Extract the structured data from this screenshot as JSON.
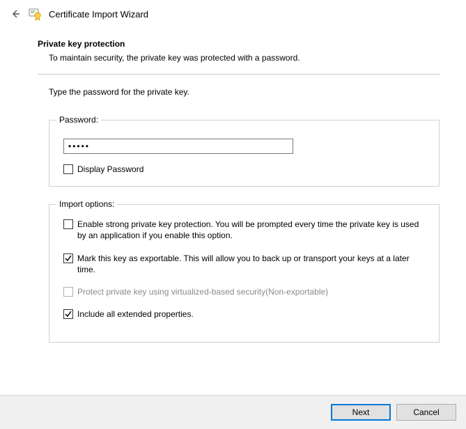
{
  "title": "Certificate Import Wizard",
  "heading": "Private key protection",
  "subheading": "To maintain security, the private key was protected with a password.",
  "instruction": "Type the password for the private key.",
  "password_group_label": "Password:",
  "password_value": "•••••",
  "display_password_label": "Display Password",
  "display_password_checked": false,
  "import_group_label": "Import options:",
  "options": [
    {
      "label": "Enable strong private key protection. You will be prompted every time the private key is used by an application if you enable this option.",
      "checked": false,
      "disabled": false
    },
    {
      "label": "Mark this key as exportable. This will allow you to back up or transport your keys at a later time.",
      "checked": true,
      "disabled": false
    },
    {
      "label": "Protect private key using virtualized-based security(Non-exportable)",
      "checked": false,
      "disabled": true
    },
    {
      "label": "Include all extended properties.",
      "checked": true,
      "disabled": false
    }
  ],
  "buttons": {
    "next": "Next",
    "cancel": "Cancel"
  }
}
